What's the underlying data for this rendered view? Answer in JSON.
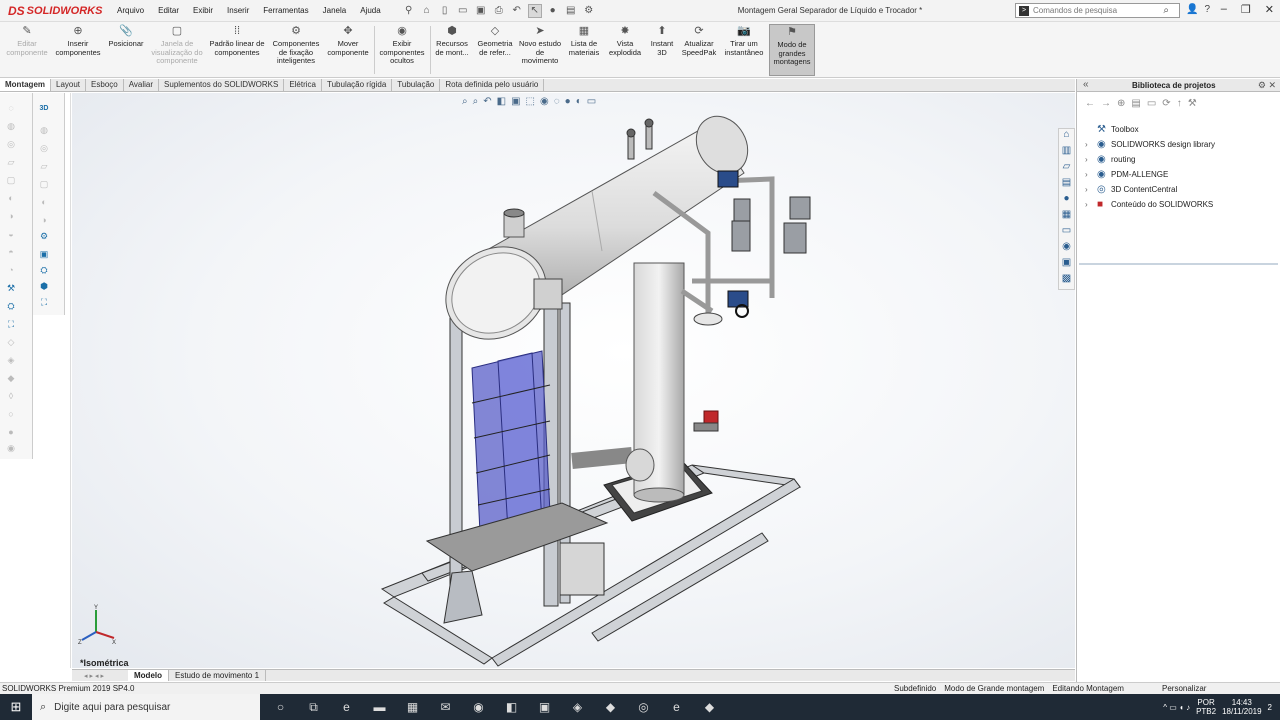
{
  "app": {
    "logo": "SOLIDWORKS",
    "logo_mark": "DS"
  },
  "menu": [
    "Arquivo",
    "Editar",
    "Exibir",
    "Inserir",
    "Ferramentas",
    "Janela",
    "Ajuda"
  ],
  "title": "Montagem Geral Separador de Líquido e Trocador *",
  "search": {
    "placeholder": "Comandos de pesquisa"
  },
  "ribbon": [
    {
      "label": "Editar componente",
      "disabled": true,
      "icon": "edit-component-icon"
    },
    {
      "label": "Inserir componentes",
      "disabled": false,
      "icon": "insert-components-icon"
    },
    {
      "label": "Posicionar",
      "disabled": false,
      "icon": "mate-icon"
    },
    {
      "label": "Janela de visualização do componente",
      "disabled": true,
      "icon": "preview-window-icon"
    },
    {
      "label": "Padrão linear de componentes",
      "disabled": false,
      "icon": "linear-pattern-icon"
    },
    {
      "label": "Componentes de fixação inteligentes",
      "disabled": false,
      "icon": "smart-fasteners-icon"
    },
    {
      "label": "Mover componente",
      "disabled": false,
      "icon": "move-component-icon"
    },
    {
      "label": "Exibir componentes ocultos",
      "disabled": false,
      "icon": "show-hidden-icon"
    },
    {
      "label": "Recursos de mont...",
      "disabled": false,
      "icon": "assembly-features-icon"
    },
    {
      "label": "Geometria de refer...",
      "disabled": false,
      "icon": "reference-geometry-icon"
    },
    {
      "label": "Novo estudo de movimento",
      "disabled": false,
      "icon": "motion-study-icon"
    },
    {
      "label": "Lista de materiais",
      "disabled": false,
      "icon": "bom-icon"
    },
    {
      "label": "Vista explodida",
      "disabled": false,
      "icon": "exploded-view-icon"
    },
    {
      "label": "Instant 3D",
      "disabled": false,
      "icon": "instant3d-icon"
    },
    {
      "label": "Atualizar SpeedPak",
      "disabled": false,
      "icon": "speedpak-icon"
    },
    {
      "label": "Tirar um instantâneo",
      "disabled": false,
      "icon": "snapshot-icon"
    },
    {
      "label": "Modo de grandes montagens",
      "disabled": false,
      "icon": "large-assembly-icon",
      "active": true
    }
  ],
  "tabs": [
    "Montagem",
    "Layout",
    "Esboço",
    "Avaliar",
    "Suplementos do SOLIDWORKS",
    "Elétrica",
    "Tubulação rígida",
    "Tubulação",
    "Rota definida pelo usuário"
  ],
  "active_tab": "Montagem",
  "view_name": "*Isométrica",
  "bottom_tabs": [
    "Modelo",
    "Estudo de movimento 1"
  ],
  "status": {
    "left": "SOLIDWORKS Premium 2019 SP4.0",
    "items": [
      "Subdefinido",
      "Modo de Grande montagem",
      "Editando Montagem"
    ],
    "customize": "Personalizar"
  },
  "panel": {
    "title": "Biblioteca de projetos",
    "tree": [
      {
        "label": "Toolbox",
        "expandable": false,
        "icon": "toolbox-icon"
      },
      {
        "label": "SOLIDWORKS design library",
        "expandable": true,
        "icon": "library-icon"
      },
      {
        "label": "routing",
        "expandable": true,
        "icon": "library-icon"
      },
      {
        "label": "PDM-ALLENGE",
        "expandable": true,
        "icon": "library-icon"
      },
      {
        "label": "3D ContentCentral",
        "expandable": true,
        "icon": "content-central-icon"
      },
      {
        "label": "Conteúdo do SOLIDWORKS",
        "expandable": true,
        "icon": "sw-content-icon"
      }
    ]
  },
  "taskbar": {
    "search_placeholder": "Digite aqui para pesquisar",
    "lang": "POR",
    "lang2": "PTB2",
    "time": "14:43",
    "date": "18/11/2019",
    "notifications": "2"
  }
}
